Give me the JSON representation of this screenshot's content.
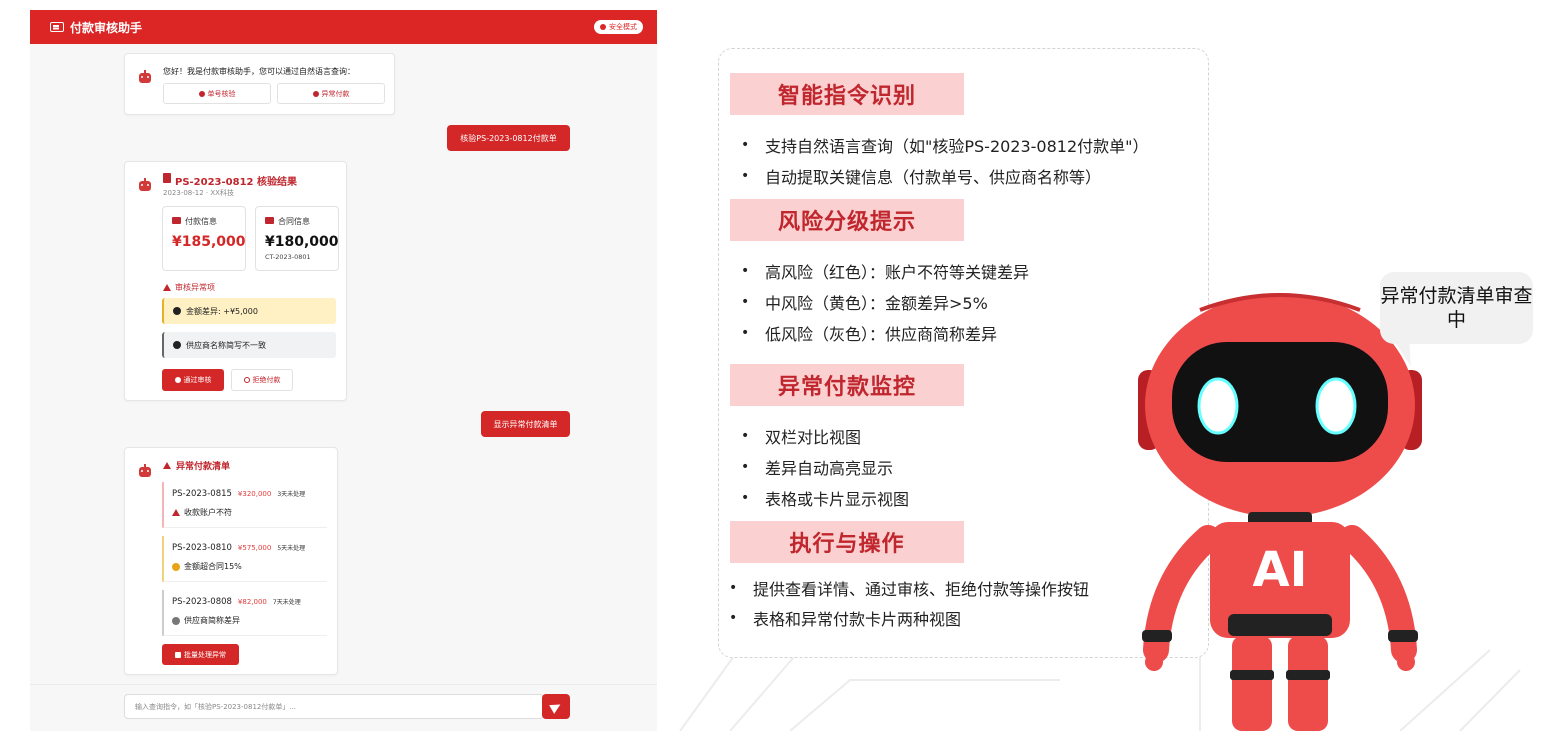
{
  "app": {
    "title": "付款审核助手",
    "secure_badge": "安全模式",
    "greeting": "您好！我是付款审核助手，您可以通过自然语言查询：",
    "quick_actions": [
      "单号核验",
      "异常付款"
    ],
    "user_messages": [
      "核验PS-2023-0812付款单",
      "显示异常付款清单"
    ],
    "result": {
      "title": "PS-2023-0812 核验结果",
      "subtitle": "2023-08-12 · XX科技",
      "payment_label": "付款信息",
      "payment_amount": "¥185,000",
      "contract_label": "合同信息",
      "contract_amount": "¥180,000",
      "contract_code": "CT-2023-0801",
      "issues_title": "审核异常项",
      "issues": [
        "金额差异: +¥5,000",
        "供应商名称简写不一致"
      ],
      "approve_label": "通过审核",
      "reject_label": "拒绝付款"
    },
    "abnormal": {
      "title": "异常付款清单",
      "items": [
        {
          "id": "PS-2023-0815",
          "amount": "¥320,000",
          "days": "3天未处理",
          "reason": "收款账户不符",
          "level": "high"
        },
        {
          "id": "PS-2023-0810",
          "amount": "¥575,000",
          "days": "5天未处理",
          "reason": "金额超合同15%",
          "level": "medium"
        },
        {
          "id": "PS-2023-0808",
          "amount": "¥82,000",
          "days": "7天未处理",
          "reason": "供应商简称差异",
          "level": "low"
        }
      ],
      "batch_label": "批量处理异常"
    },
    "input_placeholder": "输入查询指令，如「核验PS-2023-0812付款单」..."
  },
  "features": {
    "sections": [
      {
        "title": "智能指令识别",
        "bullets": [
          "支持自然语言查询（如\"核验PS-2023-0812付款单\"）",
          "自动提取关键信息（付款单号、供应商名称等）"
        ]
      },
      {
        "title": "风险分级提示",
        "bullets": [
          "高风险（红色）：账户不符等关键差异",
          "中风险（黄色）：金额差异>5%",
          "低风险（灰色）：供应商简称差异"
        ]
      },
      {
        "title": "异常付款监控",
        "bullets": [
          "双栏对比视图",
          "差异自动高亮显示",
          "表格或卡片显示视图"
        ]
      },
      {
        "title": "执行与操作",
        "bullets": [
          "提供查看详情、通过审核、拒绝付款等操作按钮",
          "表格和异常付款卡片两种视图"
        ]
      }
    ]
  },
  "robot": {
    "speech": "异常付款清单审查中",
    "chest_label": "AI"
  },
  "colors": {
    "brand_red": "#dc2626",
    "section_bg": "#fbd0d0",
    "warning_yellow": "#fff1c4",
    "neutral_gray": "#f1f2f4"
  }
}
